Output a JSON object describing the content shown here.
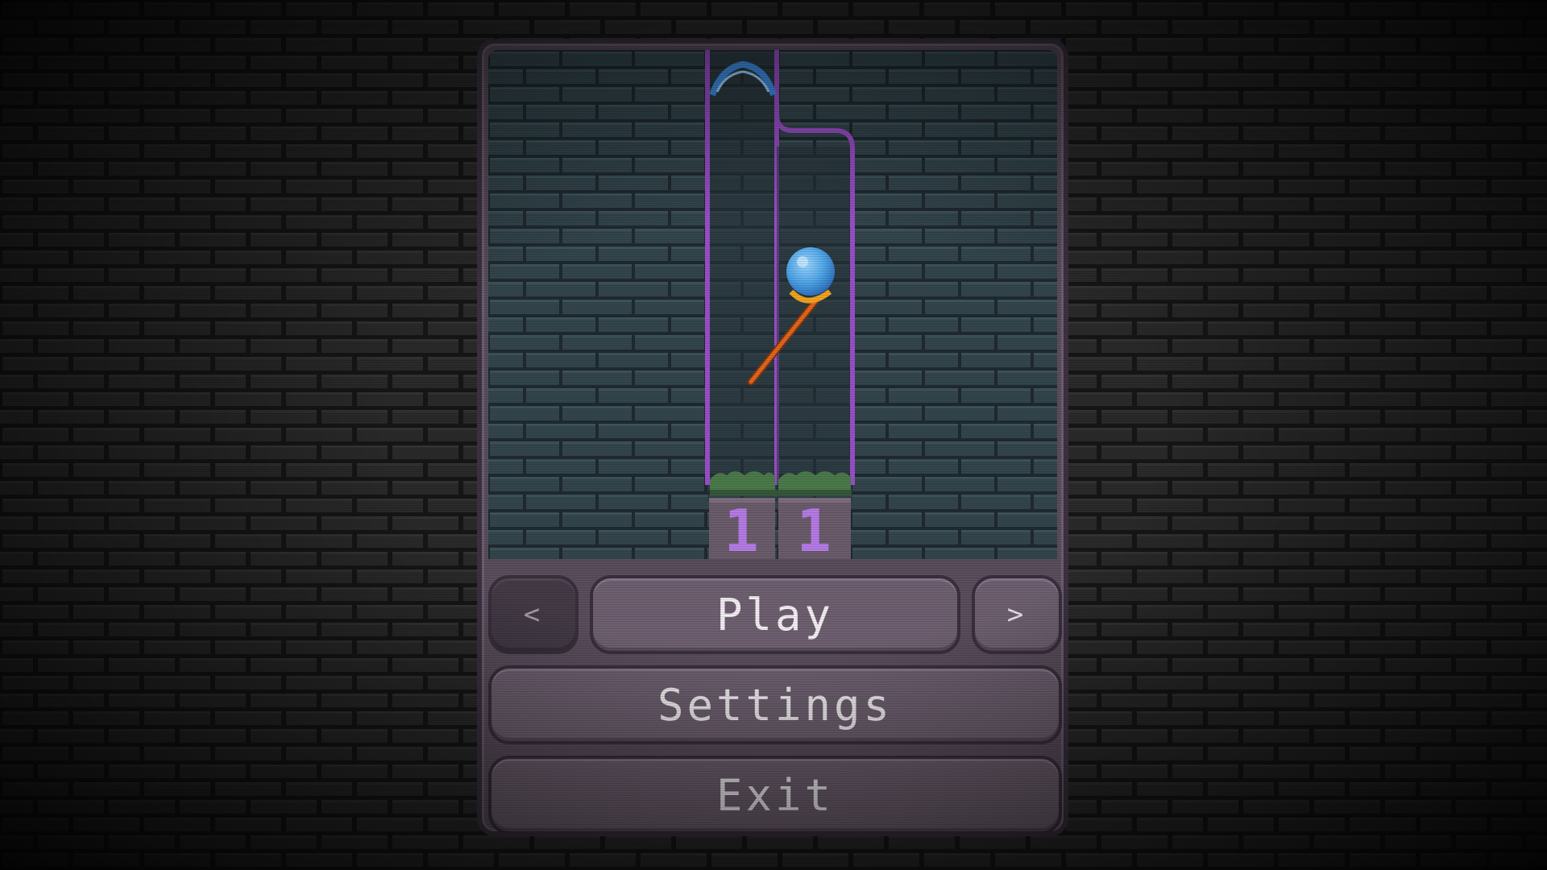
{
  "menu": {
    "prev_label": "<",
    "play_label": "Play",
    "next_label": ">",
    "settings_label": "Settings",
    "exit_label": "Exit"
  },
  "level_preview": {
    "tube_counts": [
      "1",
      "1"
    ],
    "items": [
      "portal-icon",
      "ball-icon",
      "staff-icon",
      "grass-icon"
    ]
  },
  "colors": {
    "wall_brick": "#2f3d44",
    "tube_outline": "#9a4fc9",
    "counter_digit": "#b57be6",
    "button_face": "#6e6070",
    "panel": "#5a4d5c",
    "ball": "#4fa6e8",
    "staff": "#e0661e",
    "portal": "#3f8fe8"
  }
}
